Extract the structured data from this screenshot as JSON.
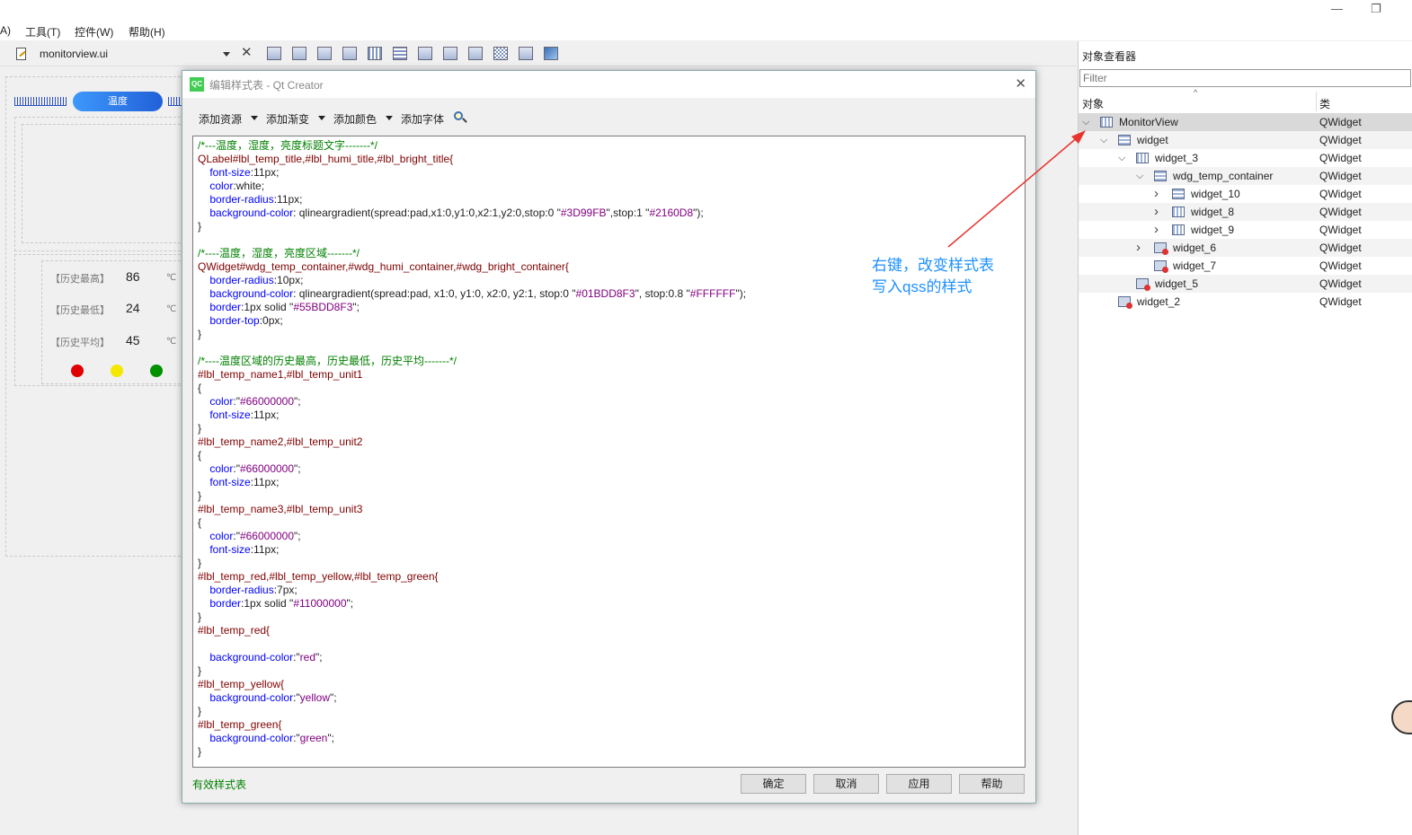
{
  "menubar": {
    "items": [
      "A)",
      "工具(T)",
      "控件(W)",
      "帮助(H)"
    ],
    "minimize": "—",
    "restore": "❐"
  },
  "filebar": {
    "filename": "monitorview.ui"
  },
  "form": {
    "title_button": "温度",
    "history": [
      {
        "label": "【历史最高】",
        "value": "86",
        "unit": "℃"
      },
      {
        "label": "【历史最低】",
        "value": "24",
        "unit": "℃"
      },
      {
        "label": "【历史平均】",
        "value": "45",
        "unit": "℃"
      }
    ],
    "indicator_colors": [
      "#e00000",
      "#f5e800",
      "#009000"
    ]
  },
  "dialog": {
    "app_icon": "QC",
    "title": "编辑样式表 - Qt Creator",
    "toolbar": {
      "add_resource": "添加资源",
      "add_gradient": "添加渐变",
      "add_color": "添加颜色",
      "add_font": "添加字体"
    },
    "status": "有效样式表",
    "buttons": {
      "ok": "确定",
      "cancel": "取消",
      "apply": "应用",
      "help": "帮助"
    }
  },
  "inspector": {
    "title": "对象查看器",
    "filter_placeholder": "Filter",
    "col_object": "对象",
    "col_class": "类",
    "rows": [
      {
        "name": "MonitorView",
        "class": "QWidget"
      },
      {
        "name": "widget",
        "class": "QWidget"
      },
      {
        "name": "widget_3",
        "class": "QWidget"
      },
      {
        "name": "wdg_temp_container",
        "class": "QWidget"
      },
      {
        "name": "widget_10",
        "class": "QWidget"
      },
      {
        "name": "widget_8",
        "class": "QWidget"
      },
      {
        "name": "widget_9",
        "class": "QWidget"
      },
      {
        "name": "widget_6",
        "class": "QWidget"
      },
      {
        "name": "widget_7",
        "class": "QWidget"
      },
      {
        "name": "widget_5",
        "class": "QWidget"
      },
      {
        "name": "widget_2",
        "class": "QWidget"
      }
    ]
  },
  "annotation": {
    "line1": "右键，改变样式表",
    "line2": "写入qss的样式",
    "color": "#1e90ff"
  },
  "stylesheet": [
    [
      {
        "t": "c",
        "x": "/*---温度，湿度，亮度标题文字-------*/"
      }
    ],
    [
      {
        "t": "s",
        "x": "QLabel#lbl_temp_title,#lbl_humi_title,#lbl_bright_title{"
      }
    ],
    [
      {
        "t": "n",
        "x": "    "
      },
      {
        "t": "p",
        "x": "font-size"
      },
      {
        "t": "n",
        "x": ":11px;"
      }
    ],
    [
      {
        "t": "n",
        "x": "    "
      },
      {
        "t": "p",
        "x": "color"
      },
      {
        "t": "n",
        "x": ":white;"
      }
    ],
    [
      {
        "t": "n",
        "x": "    "
      },
      {
        "t": "p",
        "x": "border-radius"
      },
      {
        "t": "n",
        "x": ":11px;"
      }
    ],
    [
      {
        "t": "n",
        "x": "    "
      },
      {
        "t": "p",
        "x": "background-color"
      },
      {
        "t": "n",
        "x": ": qlineargradient(spread:pad,x1:0,y1:0,x2:1,y2:0,stop:0 \""
      },
      {
        "t": "v",
        "x": "#3D99FB"
      },
      {
        "t": "n",
        "x": "\",stop:1 \""
      },
      {
        "t": "v",
        "x": "#2160D8"
      },
      {
        "t": "n",
        "x": "\");"
      }
    ],
    [
      {
        "t": "n",
        "x": "}"
      }
    ],
    [
      {
        "t": "n",
        "x": ""
      }
    ],
    [
      {
        "t": "c",
        "x": "/*----温度，湿度，亮度区域-------*/"
      }
    ],
    [
      {
        "t": "s",
        "x": "QWidget#wdg_temp_container,#wdg_humi_container,#wdg_bright_container{"
      }
    ],
    [
      {
        "t": "n",
        "x": "    "
      },
      {
        "t": "p",
        "x": "border-radius"
      },
      {
        "t": "n",
        "x": ":10px;"
      }
    ],
    [
      {
        "t": "n",
        "x": "    "
      },
      {
        "t": "p",
        "x": "background-color"
      },
      {
        "t": "n",
        "x": ": qlineargradient(spread:pad, x1:0, y1:0, x2:0, y2:1, stop:0 \""
      },
      {
        "t": "v",
        "x": "#01BDD8F3"
      },
      {
        "t": "n",
        "x": "\", stop:0.8 \""
      },
      {
        "t": "v",
        "x": "#FFFFFF"
      },
      {
        "t": "n",
        "x": "\");"
      }
    ],
    [
      {
        "t": "n",
        "x": "    "
      },
      {
        "t": "p",
        "x": "border"
      },
      {
        "t": "n",
        "x": ":1px solid \""
      },
      {
        "t": "v",
        "x": "#55BDD8F3"
      },
      {
        "t": "n",
        "x": "\";"
      }
    ],
    [
      {
        "t": "n",
        "x": "    "
      },
      {
        "t": "p",
        "x": "border-top"
      },
      {
        "t": "n",
        "x": ":0px;"
      }
    ],
    [
      {
        "t": "n",
        "x": "}"
      }
    ],
    [
      {
        "t": "n",
        "x": ""
      }
    ],
    [
      {
        "t": "c",
        "x": "/*----温度区域的历史最高，历史最低，历史平均-------*/"
      }
    ],
    [
      {
        "t": "s",
        "x": "#lbl_temp_name1,#lbl_temp_unit1"
      }
    ],
    [
      {
        "t": "n",
        "x": "{"
      }
    ],
    [
      {
        "t": "n",
        "x": "    "
      },
      {
        "t": "p",
        "x": "color"
      },
      {
        "t": "n",
        "x": ":\""
      },
      {
        "t": "v",
        "x": "#66000000"
      },
      {
        "t": "n",
        "x": "\";"
      }
    ],
    [
      {
        "t": "n",
        "x": "    "
      },
      {
        "t": "p",
        "x": "font-size"
      },
      {
        "t": "n",
        "x": ":11px;"
      }
    ],
    [
      {
        "t": "n",
        "x": "}"
      }
    ],
    [
      {
        "t": "s",
        "x": "#lbl_temp_name2,#lbl_temp_unit2"
      }
    ],
    [
      {
        "t": "n",
        "x": "{"
      }
    ],
    [
      {
        "t": "n",
        "x": "    "
      },
      {
        "t": "p",
        "x": "color"
      },
      {
        "t": "n",
        "x": ":\""
      },
      {
        "t": "v",
        "x": "#66000000"
      },
      {
        "t": "n",
        "x": "\";"
      }
    ],
    [
      {
        "t": "n",
        "x": "    "
      },
      {
        "t": "p",
        "x": "font-size"
      },
      {
        "t": "n",
        "x": ":11px;"
      }
    ],
    [
      {
        "t": "n",
        "x": "}"
      }
    ],
    [
      {
        "t": "s",
        "x": "#lbl_temp_name3,#lbl_temp_unit3"
      }
    ],
    [
      {
        "t": "n",
        "x": "{"
      }
    ],
    [
      {
        "t": "n",
        "x": "    "
      },
      {
        "t": "p",
        "x": "color"
      },
      {
        "t": "n",
        "x": ":\""
      },
      {
        "t": "v",
        "x": "#66000000"
      },
      {
        "t": "n",
        "x": "\";"
      }
    ],
    [
      {
        "t": "n",
        "x": "    "
      },
      {
        "t": "p",
        "x": "font-size"
      },
      {
        "t": "n",
        "x": ":11px;"
      }
    ],
    [
      {
        "t": "n",
        "x": "}"
      }
    ],
    [
      {
        "t": "s",
        "x": "#lbl_temp_red,#lbl_temp_yellow,#lbl_temp_green{"
      }
    ],
    [
      {
        "t": "n",
        "x": "    "
      },
      {
        "t": "p",
        "x": "border-radius"
      },
      {
        "t": "n",
        "x": ":7px;"
      }
    ],
    [
      {
        "t": "n",
        "x": "    "
      },
      {
        "t": "p",
        "x": "border"
      },
      {
        "t": "n",
        "x": ":1px solid \""
      },
      {
        "t": "v",
        "x": "#11000000"
      },
      {
        "t": "n",
        "x": "\";"
      }
    ],
    [
      {
        "t": "n",
        "x": "}"
      }
    ],
    [
      {
        "t": "s",
        "x": "#lbl_temp_red{"
      }
    ],
    [
      {
        "t": "n",
        "x": ""
      }
    ],
    [
      {
        "t": "n",
        "x": "    "
      },
      {
        "t": "p",
        "x": "background-color"
      },
      {
        "t": "n",
        "x": ":\""
      },
      {
        "t": "v",
        "x": "red"
      },
      {
        "t": "n",
        "x": "\";"
      }
    ],
    [
      {
        "t": "n",
        "x": "}"
      }
    ],
    [
      {
        "t": "s",
        "x": "#lbl_temp_yellow{"
      }
    ],
    [
      {
        "t": "n",
        "x": "    "
      },
      {
        "t": "p",
        "x": "background-color"
      },
      {
        "t": "n",
        "x": ":\""
      },
      {
        "t": "v",
        "x": "yellow"
      },
      {
        "t": "n",
        "x": "\";"
      }
    ],
    [
      {
        "t": "n",
        "x": "}"
      }
    ],
    [
      {
        "t": "s",
        "x": "#lbl_temp_green{"
      }
    ],
    [
      {
        "t": "n",
        "x": "    "
      },
      {
        "t": "p",
        "x": "background-color"
      },
      {
        "t": "n",
        "x": ":\""
      },
      {
        "t": "v",
        "x": "green"
      },
      {
        "t": "n",
        "x": "\";"
      }
    ],
    [
      {
        "t": "n",
        "x": "}"
      }
    ]
  ]
}
